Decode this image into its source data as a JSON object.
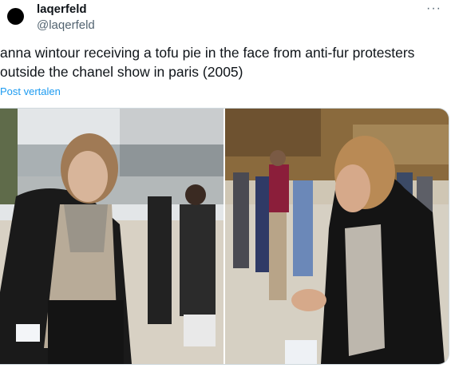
{
  "author": {
    "display_name": "laqerfeld",
    "handle": "@laqerfeld",
    "avatar_color": "#000000"
  },
  "more_menu": {
    "icon": "more-horizontal-icon",
    "glyph": "···"
  },
  "tweet": {
    "text": "anna wintour receiving a tofu pie in the face from anti-fur protesters\noutside the chanel show in paris (2005)",
    "translate_label": "Post vertalen"
  },
  "media": [
    {
      "kind": "photo",
      "description_colors": {
        "sky": "#dfe4e8",
        "ground": "#d6cfc2",
        "coat": "#1b1b1b"
      }
    },
    {
      "kind": "photo",
      "description_colors": {
        "trees": "#8a6a3d",
        "ground": "#d4cdbf",
        "coat": "#1b1b1b"
      }
    }
  ],
  "colors": {
    "link": "#1d9bf0",
    "secondary": "#536471",
    "text": "#0f1419",
    "border": "#cfd9de"
  }
}
